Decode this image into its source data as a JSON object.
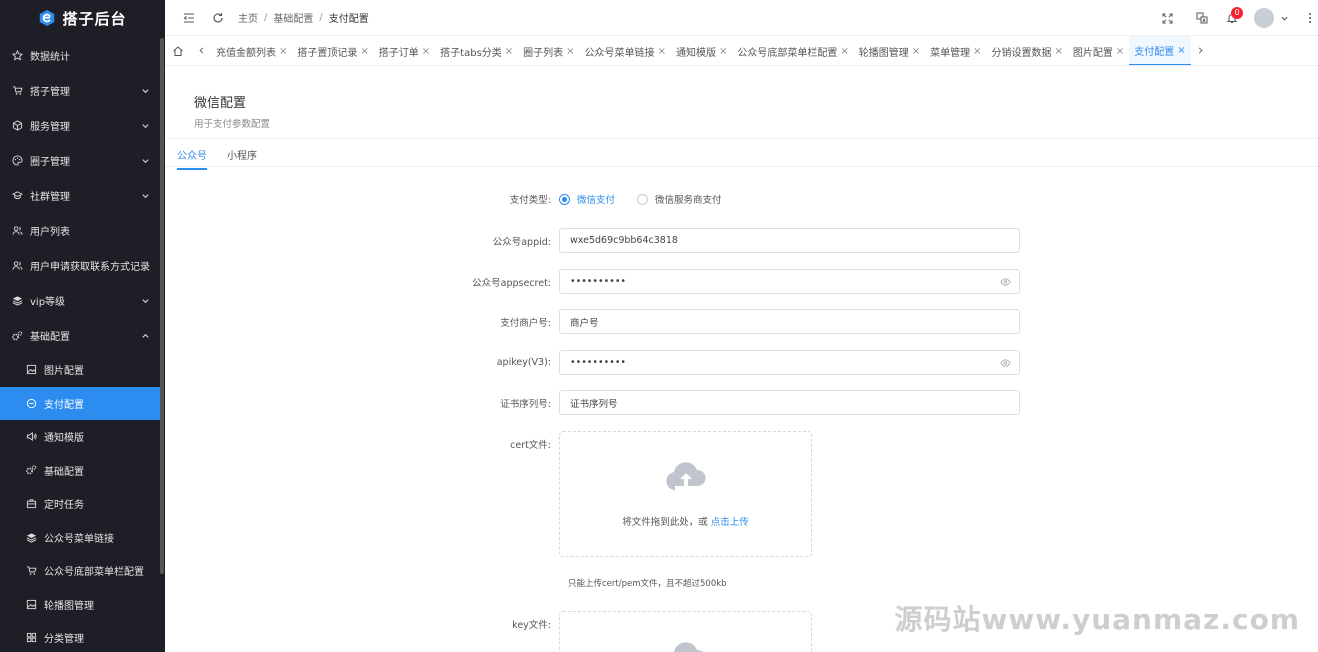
{
  "app": {
    "title": "搭子后台",
    "brand_color": "#2d8cf0",
    "sidebar_bg": "#1d1e26"
  },
  "sidebar": {
    "items": [
      {
        "label": "数据统计",
        "icon": "star-icon",
        "has_children": false
      },
      {
        "label": "搭子管理",
        "icon": "cart-icon",
        "has_children": true
      },
      {
        "label": "服务管理",
        "icon": "cube-icon",
        "has_children": true
      },
      {
        "label": "圈子管理",
        "icon": "palette-icon",
        "has_children": true
      },
      {
        "label": "社群管理",
        "icon": "cap-icon",
        "has_children": true
      },
      {
        "label": "用户列表",
        "icon": "users-icon",
        "has_children": false
      },
      {
        "label": "用户申请获取联系方式记录",
        "icon": "users-icon",
        "has_children": false
      },
      {
        "label": "vip等级",
        "icon": "layers-icon",
        "has_children": true
      },
      {
        "label": "基础配置",
        "icon": "gears-icon",
        "has_children": true,
        "expanded": true
      }
    ],
    "submenu": [
      {
        "label": "图片配置",
        "icon": "image-icon"
      },
      {
        "label": "支付配置",
        "icon": "minus-circle-icon",
        "active": true
      },
      {
        "label": "通知模版",
        "icon": "speaker-icon"
      },
      {
        "label": "基础配置",
        "icon": "gears-icon"
      },
      {
        "label": "定时任务",
        "icon": "briefcase-icon"
      },
      {
        "label": "公众号菜单链接",
        "icon": "layers-icon"
      },
      {
        "label": "公众号底部菜单栏配置",
        "icon": "cart-icon"
      },
      {
        "label": "轮播图管理",
        "icon": "image-icon"
      },
      {
        "label": "分类管理",
        "icon": "grid-icon"
      }
    ]
  },
  "header": {
    "breadcrumb": [
      "主页",
      "基础配置",
      "支付配置"
    ],
    "notification_count": "0"
  },
  "tabs": [
    {
      "label": "充值金额列表"
    },
    {
      "label": "搭子置顶记录"
    },
    {
      "label": "搭子订单"
    },
    {
      "label": "搭子tabs分类"
    },
    {
      "label": "圈子列表"
    },
    {
      "label": "公众号菜单链接"
    },
    {
      "label": "通知模版"
    },
    {
      "label": "公众号底部菜单栏配置"
    },
    {
      "label": "轮播图管理"
    },
    {
      "label": "菜单管理"
    },
    {
      "label": "分销设置数据"
    },
    {
      "label": "图片配置"
    },
    {
      "label": "支付配置",
      "active": true
    }
  ],
  "page": {
    "title": "微信配置",
    "subtitle": "用于支付参数配置",
    "subtabs": [
      {
        "label": "公众号",
        "active": true
      },
      {
        "label": "小程序"
      }
    ]
  },
  "form": {
    "pay_type": {
      "label": "支付类型:",
      "options": [
        {
          "label": "微信支付",
          "checked": true
        },
        {
          "label": "微信服务商支付",
          "checked": false
        }
      ]
    },
    "appid": {
      "label": "公众号appid:",
      "value": "wxe5d69c9bb64c3818"
    },
    "appsecret": {
      "label": "公众号appsecret:",
      "value": "••••••••••"
    },
    "mch_id": {
      "label": "支付商户号:",
      "value": "商户号"
    },
    "apikey": {
      "label": "apikey(V3):",
      "value": "••••••••••"
    },
    "cert_serial": {
      "label": "证书序列号:",
      "value": "证书序列号"
    },
    "cert_file": {
      "label": "cert文件:",
      "drop_text": "将文件拖到此处，或",
      "link_text": "点击上传",
      "hint": "只能上传cert/pem文件，且不超过500kb"
    },
    "key_file": {
      "label": "key文件:"
    }
  },
  "watermark": "源码站www.yuanmaz.com"
}
